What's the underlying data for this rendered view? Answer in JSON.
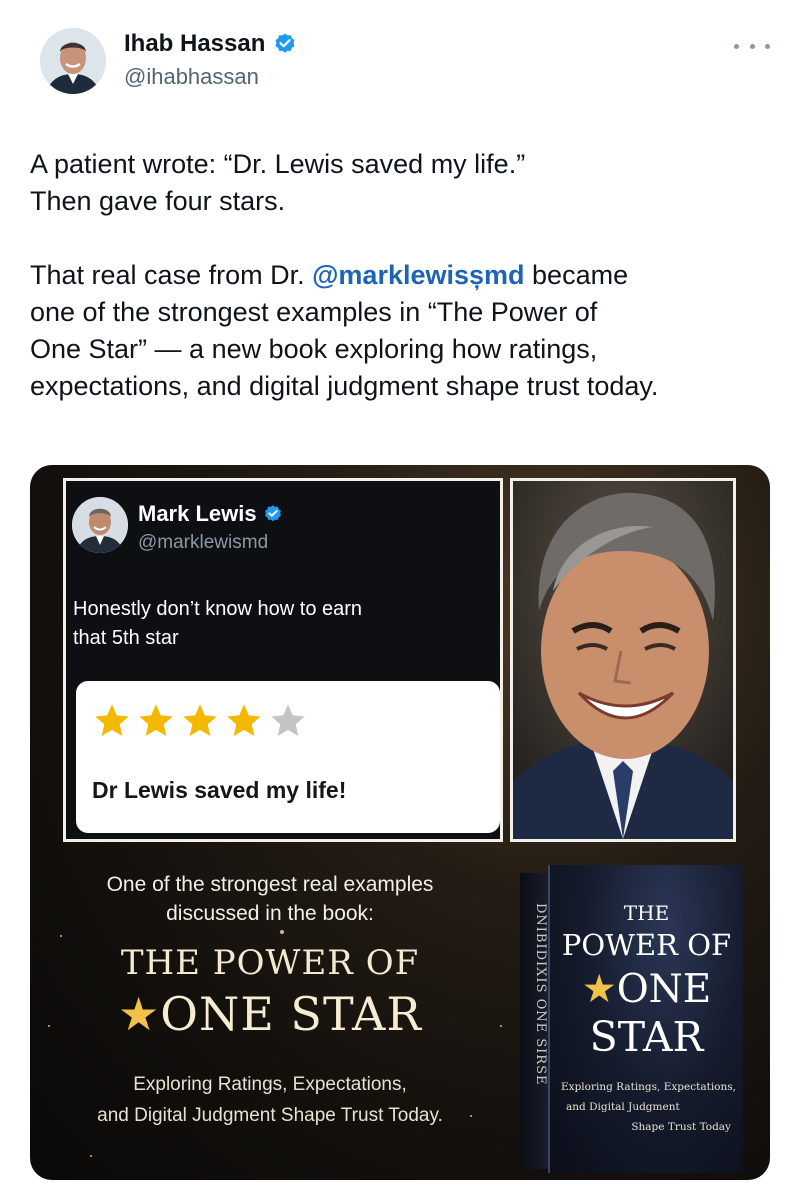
{
  "author": {
    "display_name": "Ihab Hassan",
    "handle": "@ihabhassan",
    "verified": true,
    "icons": {
      "verified": "verified-badge-icon",
      "more": "more-horizontal-icon"
    }
  },
  "tweet": {
    "line1": "A patient wrote: “Dr. Lewis saved my life.”",
    "line2": "Then gave four stars.",
    "para2_prefix": "That real case from Dr. ",
    "mention": "@marklewisșmd",
    "para2_line1_suffix": " became",
    "para2_line2": "one of the strongest examples in “The Power of",
    "para2_line3": "One Star” — a new book exploring how ratings,",
    "para2_line4": "expectations, and digital judgment shape trust today."
  },
  "media": {
    "inner_tweet": {
      "display_name": "Mark Lewis",
      "handle": "@marklewismd",
      "text_line1": "Honestly don’t know how to earn",
      "text_line2": "that 5th star",
      "rating": 4,
      "rating_max": 5,
      "review": "Dr Lewis saved my life!",
      "colors": {
        "star_filled": "#f5b800",
        "star_empty": "#c4c4c4"
      }
    },
    "promo": {
      "lead_line1": "One of the strongest real examples",
      "lead_line2": "discussed in the book:",
      "title_line1": "THE POWER OF",
      "title_star": "★",
      "title_line2": "ONE STAR",
      "sub_line1": "Exploring Ratings, Expectations,",
      "sub_line2": "and Digital Judgment Shape Trust Today."
    },
    "book": {
      "spine": "DNIBIDIXIS ONE SIRSE",
      "cover_line1": "THE",
      "cover_line2": "POWER OF",
      "cover_star": "★",
      "cover_line3": "ONE",
      "cover_line4": "STAR",
      "cover_sub1": "Exploring Ratings, Expectations,",
      "cover_sub2": "and Digital Judgment",
      "cover_sub3": "Shape Trust Today"
    }
  },
  "colors": {
    "mention": "#1d64b7",
    "verified": "#1d9bf0",
    "gold": "#f0c24a"
  }
}
